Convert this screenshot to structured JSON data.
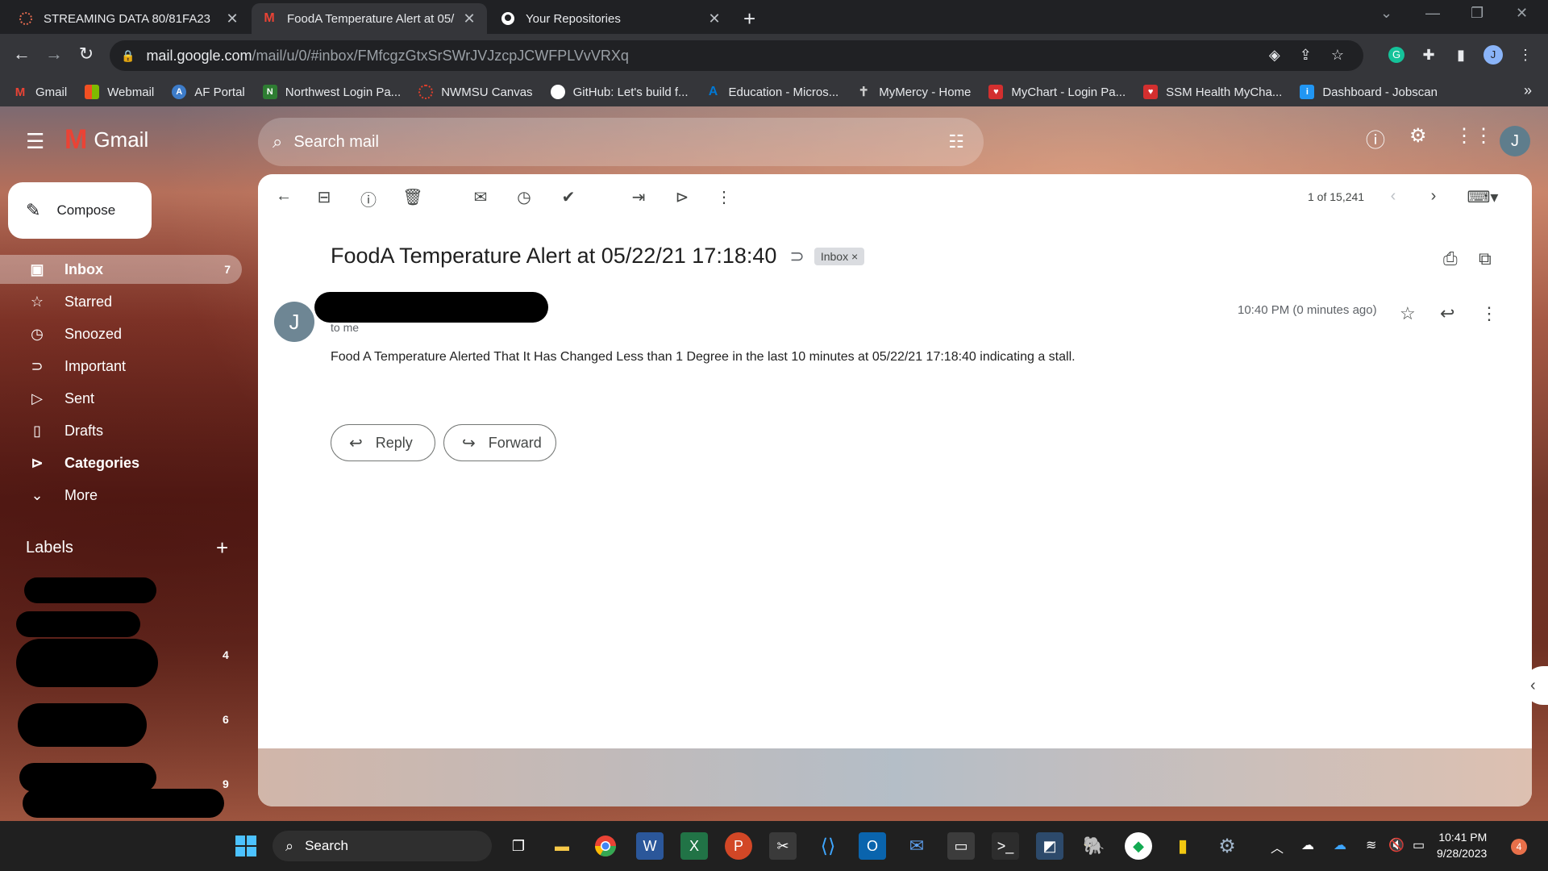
{
  "browser": {
    "tabs": [
      {
        "title": "STREAMING DATA 80/81FA23",
        "icon": "dotted-ring-icon",
        "color": "#e06a4f"
      },
      {
        "title": "FoodA Temperature Alert at 05/",
        "icon": "gmail-icon",
        "color": "#ea4335"
      },
      {
        "title": "Your Repositories",
        "icon": "github-icon",
        "color": "#ffffff"
      }
    ],
    "address": {
      "host": "mail.google.com",
      "path": "/mail/u/0/#inbox/FMfcgzGtxSrSWrJVJzcpJCWFPLVvVRXq"
    },
    "profile_initial": "J",
    "bookmarks": [
      {
        "label": "Gmail",
        "icon": "gmail-icon",
        "color": "#ea4335"
      },
      {
        "label": "Webmail",
        "icon": "microsoft-icon",
        "color": "#f25022"
      },
      {
        "label": "AF Portal",
        "icon": "af-portal-icon",
        "color": "#3d7cc9"
      },
      {
        "label": "Northwest Login Pa...",
        "icon": "northwest-icon",
        "color": "#2e7d32"
      },
      {
        "label": "NWMSU Canvas",
        "icon": "canvas-icon",
        "color": "#e13f2b"
      },
      {
        "label": "GitHub: Let's build f...",
        "icon": "github-icon",
        "color": "#ffffff"
      },
      {
        "label": "Education - Micros...",
        "icon": "azure-icon",
        "color": "#0078d4"
      },
      {
        "label": "MyMercy - Home",
        "icon": "mercy-icon",
        "color": "#c9c9c9"
      },
      {
        "label": "MyChart - Login Pa...",
        "icon": "mychart-icon",
        "color": "#d32f2f"
      },
      {
        "label": "SSM Health MyCha...",
        "icon": "ssm-icon",
        "color": "#d32f2f"
      },
      {
        "label": "Dashboard - Jobscan",
        "icon": "jobscan-icon",
        "color": "#2196f3"
      }
    ]
  },
  "gmail": {
    "logo_text": "Gmail",
    "search_placeholder": "Search mail",
    "compose_label": "Compose",
    "nav": [
      {
        "label": "Inbox",
        "icon": "inbox-icon",
        "count": "7",
        "active": true
      },
      {
        "label": "Starred",
        "icon": "star-icon",
        "count": ""
      },
      {
        "label": "Snoozed",
        "icon": "clock-icon",
        "count": ""
      },
      {
        "label": "Important",
        "icon": "important-icon",
        "count": ""
      },
      {
        "label": "Sent",
        "icon": "send-icon",
        "count": ""
      },
      {
        "label": "Drafts",
        "icon": "draft-icon",
        "count": ""
      },
      {
        "label": "Categories",
        "icon": "label-icon",
        "count": ""
      },
      {
        "label": "More",
        "icon": "chevron-down-icon",
        "count": ""
      }
    ],
    "labels_heading": "Labels",
    "label_counts": [
      "4",
      "6",
      "9"
    ],
    "page_info": "1 of 15,241",
    "email": {
      "subject": "FoodA Temperature Alert at 05/22/21 17:18:40",
      "chip": "Inbox",
      "sender_initial": "J",
      "to": "to me",
      "time": "10:40 PM (0 minutes ago)",
      "body": "Food A Temperature Alerted That It Has Changed Less than 1 Degree in the last 10 minutes at 05/22/21 17:18:40 indicating a stall.",
      "reply_label": "Reply",
      "forward_label": "Forward"
    }
  },
  "taskbar": {
    "search_label": "Search",
    "time": "10:41 PM",
    "date": "9/28/2023",
    "notification_count": "4"
  }
}
